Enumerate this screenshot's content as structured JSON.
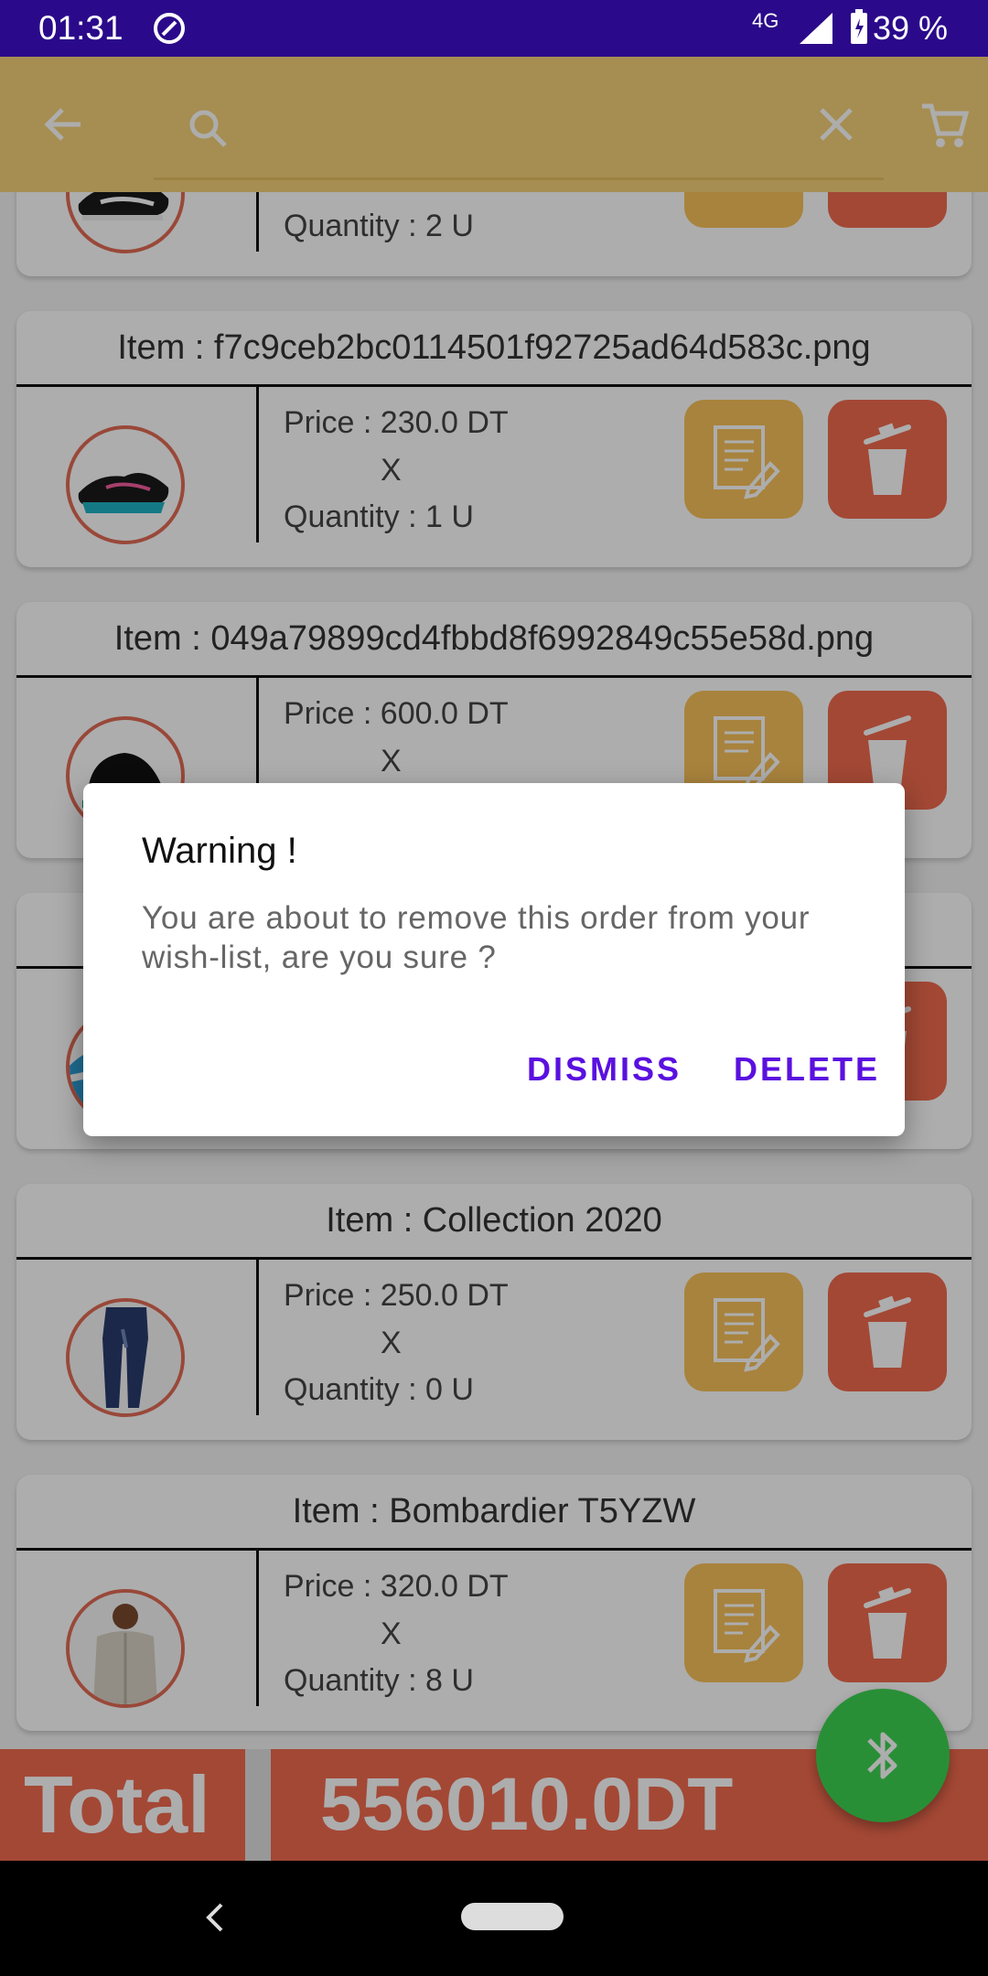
{
  "status_bar": {
    "time": "01:31",
    "network": "4G",
    "battery": "39 %"
  },
  "toolbar": {
    "search_placeholder": ""
  },
  "orders": [
    {
      "title": "",
      "price_label": "",
      "x": "",
      "quantity_label": "Quantity : 2 U",
      "thumb": "sneaker-black-white"
    },
    {
      "title": "Item : f7c9ceb2bc0114501f92725ad64d583c.png",
      "price_label": "Price : 230.0 DT",
      "x": "X",
      "quantity_label": "Quantity : 1 U",
      "thumb": "sneaker-black-teal"
    },
    {
      "title": "Item : 049a79899cd4fbbd8f6992849c55e58d.png",
      "price_label": "Price : 600.0 DT",
      "x": "X",
      "quantity_label": "",
      "thumb": "boot-black"
    },
    {
      "title": "",
      "price_label": "",
      "x": "",
      "quantity_label": "",
      "thumb": "sneaker-blue"
    },
    {
      "title": "Item : Collection 2020",
      "price_label": "Price : 250.0 DT",
      "x": "X",
      "quantity_label": "Quantity : 0 U",
      "thumb": "jeans"
    },
    {
      "title": "Item : Bombardier T5YZW",
      "price_label": "Price : 320.0 DT",
      "x": "X",
      "quantity_label": "Quantity : 8 U",
      "thumb": "jacket"
    }
  ],
  "total": {
    "label": "Total",
    "value": "556010.0DT"
  },
  "dialog": {
    "title": "Warning !",
    "message": "You are about to remove this order from your wish-list, are you sure ?",
    "dismiss": "DISMISS",
    "delete": "DELETE"
  },
  "colors": {
    "status_bar": "#2a0a8a",
    "toolbar": "#f5d27a",
    "edit_button": "#f8c15a",
    "delete_button": "#f06a4e",
    "fab": "#3dd352",
    "dialog_action": "#5a10e0"
  },
  "icons": [
    "back-arrow-icon",
    "search-icon",
    "close-icon",
    "cart-icon",
    "edit-document-icon",
    "trash-icon",
    "bluetooth-icon",
    "nav-back-icon"
  ]
}
